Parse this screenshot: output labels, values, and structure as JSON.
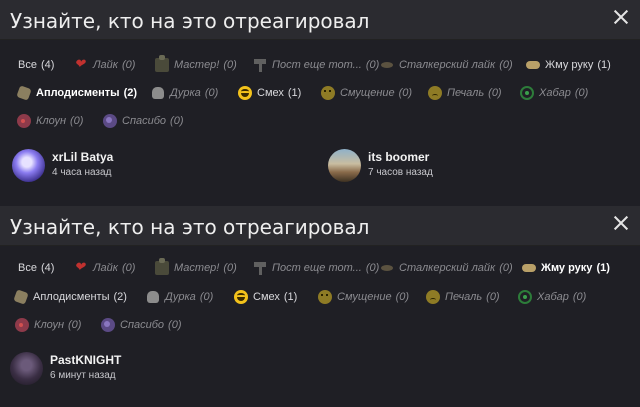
{
  "colors": {
    "background": "#1f1f25",
    "header": "#2b2b30",
    "active_text": "#ffffff",
    "muted_text": "#8b8b90"
  },
  "panels": [
    {
      "title": "Узнайте, кто на это отреагировал",
      "tabs": [
        {
          "label": "Все",
          "count": "(4)",
          "icon": "none",
          "state": "plain"
        },
        {
          "label": "Лайк",
          "count": "(0)",
          "icon": "heart-icon",
          "state": "muted"
        },
        {
          "label": "Мастер!",
          "count": "(0)",
          "icon": "toolbox-icon",
          "state": "muted"
        },
        {
          "label": "Пост еще тот...",
          "count": "(0)",
          "icon": "hammer-icon",
          "state": "muted"
        },
        {
          "label": "Сталкерский лайк",
          "count": "(0)",
          "icon": "pawprint-icon",
          "state": "muted"
        },
        {
          "label": "Жму руку",
          "count": "(1)",
          "icon": "handshake-icon",
          "state": "plain"
        },
        {
          "label": "Аплодисменты",
          "count": "(2)",
          "icon": "clap-icon",
          "state": "active"
        },
        {
          "label": "Дурка",
          "count": "(0)",
          "icon": "skull-icon",
          "state": "muted"
        },
        {
          "label": "Смех",
          "count": "(1)",
          "icon": "laugh-icon",
          "state": "plain"
        },
        {
          "label": "Смущение",
          "count": "(0)",
          "icon": "confused-icon",
          "state": "muted"
        },
        {
          "label": "Печаль",
          "count": "(0)",
          "icon": "sad-icon",
          "state": "muted"
        },
        {
          "label": "Хабар",
          "count": "(0)",
          "icon": "loot-icon",
          "state": "muted"
        },
        {
          "label": "Клоун",
          "count": "(0)",
          "icon": "clown-icon",
          "state": "muted"
        },
        {
          "label": "Спасибо",
          "count": "(0)",
          "icon": "thanks-icon",
          "state": "muted"
        }
      ],
      "users": [
        {
          "name": "xrLil Batya",
          "time": "4 часа назад"
        },
        {
          "name": "its boomer",
          "time": "7 часов назад"
        }
      ]
    },
    {
      "title": "Узнайте, кто на это отреагировал",
      "tabs": [
        {
          "label": "Все",
          "count": "(4)",
          "icon": "none",
          "state": "plain"
        },
        {
          "label": "Лайк",
          "count": "(0)",
          "icon": "heart-icon",
          "state": "muted"
        },
        {
          "label": "Мастер!",
          "count": "(0)",
          "icon": "toolbox-icon",
          "state": "muted"
        },
        {
          "label": "Пост еще тот...",
          "count": "(0)",
          "icon": "hammer-icon",
          "state": "muted"
        },
        {
          "label": "Сталкерский лайк",
          "count": "(0)",
          "icon": "pawprint-icon",
          "state": "muted"
        },
        {
          "label": "Жму руку",
          "count": "(1)",
          "icon": "handshake-icon",
          "state": "active"
        },
        {
          "label": "Аплодисменты",
          "count": "(2)",
          "icon": "clap-icon",
          "state": "plain"
        },
        {
          "label": "Дурка",
          "count": "(0)",
          "icon": "skull-icon",
          "state": "muted"
        },
        {
          "label": "Смех",
          "count": "(1)",
          "icon": "laugh-icon",
          "state": "plain"
        },
        {
          "label": "Смущение",
          "count": "(0)",
          "icon": "confused-icon",
          "state": "muted"
        },
        {
          "label": "Печаль",
          "count": "(0)",
          "icon": "sad-icon",
          "state": "muted"
        },
        {
          "label": "Хабар",
          "count": "(0)",
          "icon": "loot-icon",
          "state": "muted"
        },
        {
          "label": "Клоун",
          "count": "(0)",
          "icon": "clown-icon",
          "state": "muted"
        },
        {
          "label": "Спасибо",
          "count": "(0)",
          "icon": "thanks-icon",
          "state": "muted"
        }
      ],
      "users": [
        {
          "name": "PastKNIGHT",
          "time": "6 минут назад"
        }
      ]
    }
  ]
}
